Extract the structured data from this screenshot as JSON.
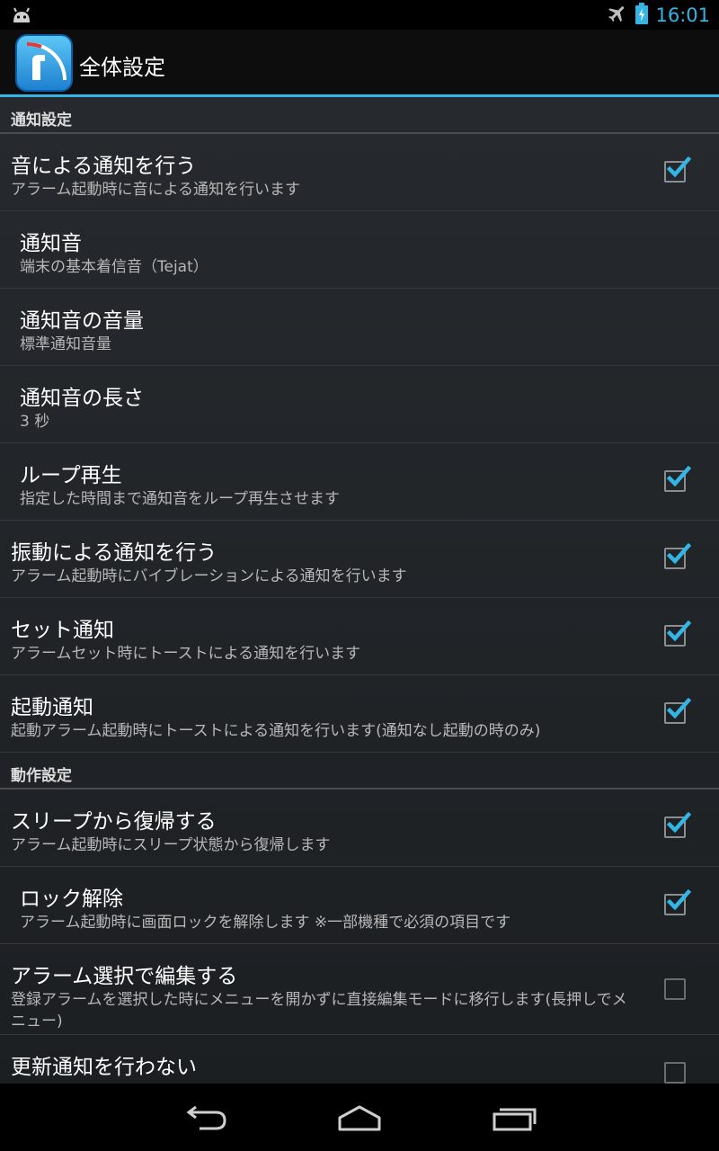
{
  "status_bar": {
    "time": "16:01",
    "icons": [
      "android-icon",
      "airplane-icon",
      "battery-charging-icon"
    ]
  },
  "action_bar": {
    "title": "全体設定",
    "app_icon": "app-logo-icon"
  },
  "categories": [
    {
      "label": "通知設定",
      "items": [
        {
          "title": "音による通知を行う",
          "summary": "アラーム起動時に音による通知を行います",
          "checked": true,
          "indent": false
        },
        {
          "title": "通知音",
          "summary": "端末の基本着信音（Tejat）",
          "checked": null,
          "indent": true
        },
        {
          "title": "通知音の音量",
          "summary": "標準通知音量",
          "checked": null,
          "indent": true
        },
        {
          "title": "通知音の長さ",
          "summary": "3 秒",
          "checked": null,
          "indent": true
        },
        {
          "title": "ループ再生",
          "summary": "指定した時間まで通知音をループ再生させます",
          "checked": true,
          "indent": true
        },
        {
          "title": "振動による通知を行う",
          "summary": "アラーム起動時にバイブレーションによる通知を行います",
          "checked": true,
          "indent": false
        },
        {
          "title": "セット通知",
          "summary": "アラームセット時にトーストによる通知を行います",
          "checked": true,
          "indent": false
        },
        {
          "title": "起動通知",
          "summary": "起動アラーム起動時にトーストによる通知を行います(通知なし起動の時のみ)",
          "checked": true,
          "indent": false
        }
      ]
    },
    {
      "label": "動作設定",
      "items": [
        {
          "title": "スリープから復帰する",
          "summary": "アラーム起動時にスリープ状態から復帰します",
          "checked": true,
          "indent": false
        },
        {
          "title": "ロック解除",
          "summary": "アラーム起動時に画面ロックを解除します ※一部機種で必須の項目です",
          "checked": true,
          "indent": true
        },
        {
          "title": "アラーム選択で編集する",
          "summary": "登録アラームを選択した時にメニューを開かずに直接編集モードに移行します(長押しでメニュー)",
          "checked": false,
          "indent": false
        },
        {
          "title": "更新通知を行わない",
          "summary": "",
          "checked": false,
          "indent": false
        }
      ]
    }
  ],
  "nav_bar": {
    "buttons": [
      "back-icon",
      "home-icon",
      "recent-apps-icon"
    ]
  },
  "colors": {
    "accent": "#33b5e5",
    "background_top": "#262a2e",
    "background_bottom": "#1c1f22"
  }
}
